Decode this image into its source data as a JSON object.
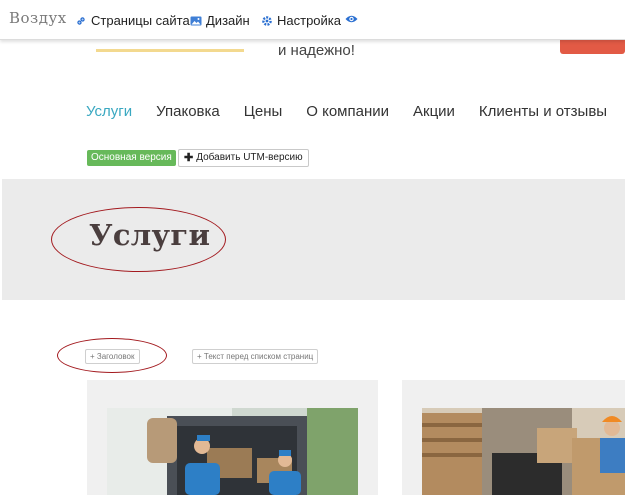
{
  "toolbar": {
    "logo": "Воздух",
    "pages_label": "Страницы сайта",
    "design_label": "Дизайн",
    "settings_label": "Настройка"
  },
  "header": {
    "tagline": "и надежно!"
  },
  "nav": {
    "items": [
      "Услуги",
      "Упаковка",
      "Цены",
      "О компании",
      "Акции",
      "Клиенты и отзывы"
    ],
    "active_index": 0
  },
  "versions": {
    "main_label": "Основная версия",
    "add_utm_label": "Добавить UTM-версию"
  },
  "hero": {
    "title": "Услуги"
  },
  "placeholders": {
    "heading_label": "+ Заголовок",
    "text_before_list_label": "+ Текст перед списком страниц"
  },
  "colors": {
    "accent": "#3aa8c1",
    "green_badge": "#67b95a",
    "annotation_red": "#a31a1f",
    "cta_red": "#e25a45"
  }
}
